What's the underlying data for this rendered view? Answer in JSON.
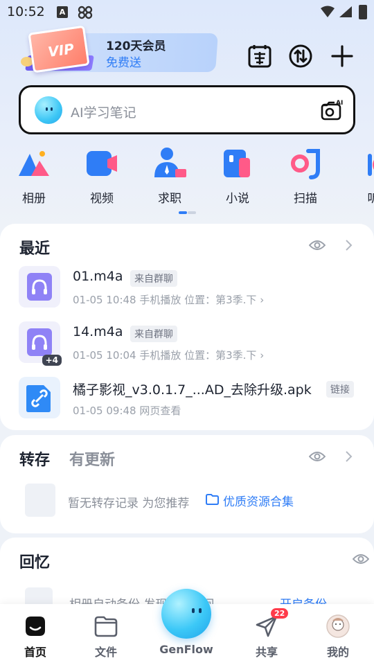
{
  "status_bar": {
    "time": "10:52",
    "icon_a": "A"
  },
  "header": {
    "vip_badge": "VIP",
    "vip_title": "120天会员",
    "vip_subtitle": "免费送"
  },
  "search": {
    "placeholder": "AI学习笔记"
  },
  "quick_access": [
    {
      "label": "相册",
      "icon": "album-icon"
    },
    {
      "label": "视频",
      "icon": "video-icon"
    },
    {
      "label": "求职",
      "icon": "job-icon"
    },
    {
      "label": "小说",
      "icon": "novel-icon"
    },
    {
      "label": "扫描",
      "icon": "scan-icon"
    },
    {
      "label": "听",
      "icon": "listen-icon"
    }
  ],
  "recent": {
    "title": "最近",
    "files": [
      {
        "name": "01.m4a",
        "tag": "来自群聊",
        "meta": "01-05 10:48  手机播放  位置：第3季.下 ›"
      },
      {
        "name": "14.m4a",
        "tag": "来自群聊",
        "meta": "01-05 10:04  手机播放  位置：第3季.下 ›",
        "extra_count": "+4"
      },
      {
        "name": "橘子影视_v3.0.1.7_...AD_去除升级.apk",
        "tag": "链接",
        "meta": "01-05 09:48  网页查看"
      }
    ]
  },
  "transfer": {
    "title": "转存",
    "subtitle": "有更新",
    "empty_text": "暂无转存记录 为您推荐",
    "link": "优质资源合集"
  },
  "memory": {
    "title": "回忆",
    "text": "相册自动备份 发现回忆瞬间",
    "link": "开启备份"
  },
  "bottom_nav": {
    "home": "首页",
    "files": "文件",
    "genflow": "GenFlow",
    "share": "共享",
    "share_badge": "22",
    "me": "我的"
  },
  "colors": {
    "accent": "#2f7df6",
    "badge": "#ff3b4a"
  }
}
